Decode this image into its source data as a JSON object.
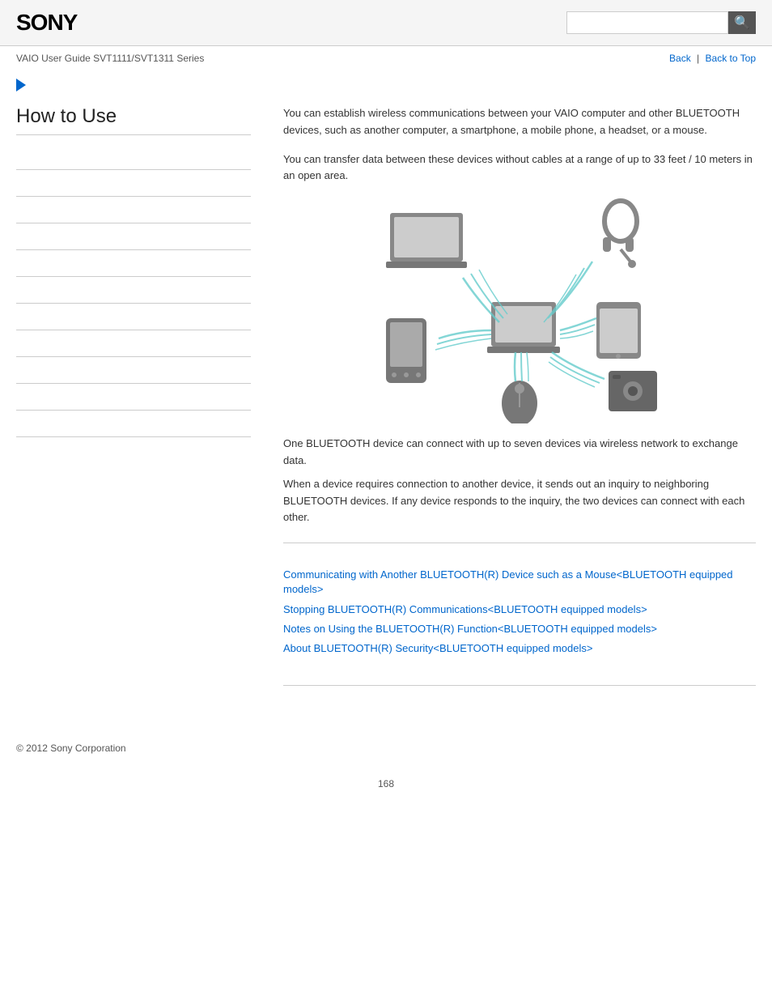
{
  "header": {
    "logo": "SONY",
    "search_placeholder": "",
    "search_icon": "🔍"
  },
  "nav": {
    "guide_title": "VAIO User Guide SVT1111/SVT1311 Series",
    "back_label": "Back",
    "back_to_top_label": "Back to Top"
  },
  "breadcrumb": {
    "arrow_icon": "chevron-right-icon"
  },
  "sidebar": {
    "title": "How to Use",
    "items": [
      {
        "label": ""
      },
      {
        "label": ""
      },
      {
        "label": ""
      },
      {
        "label": ""
      },
      {
        "label": ""
      },
      {
        "label": ""
      },
      {
        "label": ""
      },
      {
        "label": ""
      },
      {
        "label": ""
      },
      {
        "label": ""
      },
      {
        "label": ""
      }
    ]
  },
  "content": {
    "intro_para1": "You can establish wireless communications between your VAIO computer and other BLUETOOTH devices, such as another computer, a smartphone, a mobile phone, a headset, or a mouse.",
    "intro_para2": "You can transfer data between these devices without cables at a range of up to 33 feet / 10 meters in an open area.",
    "body_para1": "One BLUETOOTH device can connect with up to seven devices via wireless network to exchange data.",
    "body_para2": "When a device requires connection to another device, it sends out an inquiry to neighboring BLUETOOTH devices. If any device responds to the inquiry, the two devices can connect with each other.",
    "related_links": [
      "Communicating with Another BLUETOOTH(R) Device such as a Mouse<BLUETOOTH equipped models>",
      "Stopping BLUETOOTH(R) Communications<BLUETOOTH equipped models>",
      "Notes on Using the BLUETOOTH(R) Function<BLUETOOTH equipped models>",
      "About BLUETOOTH(R) Security<BLUETOOTH equipped models>"
    ]
  },
  "footer": {
    "copyright": "© 2012 Sony Corporation"
  },
  "page_number": "168"
}
